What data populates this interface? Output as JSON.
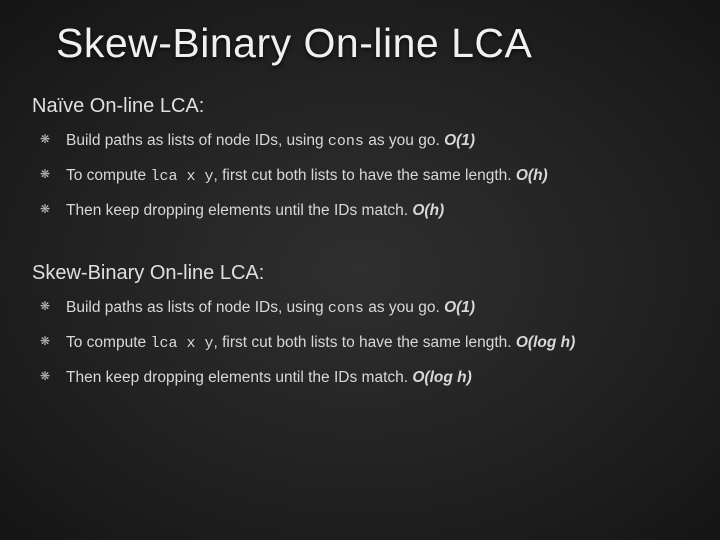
{
  "title": "Skew-Binary On-line LCA",
  "sections": [
    {
      "heading": "Naïve On-line LCA:",
      "bullets": [
        {
          "pre": "Build paths as lists of node IDs, using ",
          "code": "cons",
          "post": " as you go. ",
          "complexity": "O(1)"
        },
        {
          "pre": "To compute ",
          "code": "lca x y",
          "post": ", first cut both lists to have the same length. ",
          "complexity": "O(h)"
        },
        {
          "pre": "Then keep dropping elements until the IDs match. ",
          "code": "",
          "post": "",
          "complexity": "O(h)"
        }
      ]
    },
    {
      "heading": "Skew-Binary On-line LCA:",
      "bullets": [
        {
          "pre": "Build paths as lists of node IDs, using ",
          "code": "cons",
          "post": " as you go. ",
          "complexity": "O(1)"
        },
        {
          "pre": "To compute ",
          "code": "lca x y",
          "post": ", first cut both lists to have the same length. ",
          "complexity": "O(log h)"
        },
        {
          "pre": "Then keep dropping elements until the IDs match. ",
          "code": "",
          "post": "",
          "complexity": "O(log h)"
        }
      ]
    }
  ]
}
